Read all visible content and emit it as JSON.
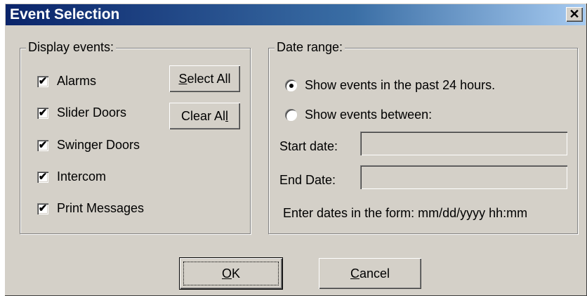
{
  "window": {
    "title": "Event Selection",
    "close_glyph": "✕"
  },
  "display_events": {
    "legend": "Display events:",
    "items": [
      {
        "label": "Alarms",
        "checked": true
      },
      {
        "label": "Slider Doors",
        "checked": true
      },
      {
        "label": "Swinger Doors",
        "checked": true
      },
      {
        "label": "Intercom",
        "checked": true
      },
      {
        "label": "Print Messages",
        "checked": true
      }
    ],
    "select_all": {
      "accel": "S",
      "rest": "elect All"
    },
    "clear_all": {
      "pre": "Clear Al",
      "accel": "l"
    }
  },
  "date_range": {
    "legend": "Date range:",
    "option_past_24": {
      "label": "Show events in the past 24 hours.",
      "selected": true
    },
    "option_between": {
      "label": "Show events between:",
      "selected": false
    },
    "start_date_label": "Start date:",
    "start_date_value": "",
    "end_date_label": "End Date:",
    "end_date_value": "",
    "hint": "Enter dates in the form: mm/dd/yyyy hh:mm"
  },
  "buttons": {
    "ok": {
      "accel": "O",
      "rest": "K"
    },
    "cancel": {
      "accel": "C",
      "rest": "ancel"
    }
  }
}
